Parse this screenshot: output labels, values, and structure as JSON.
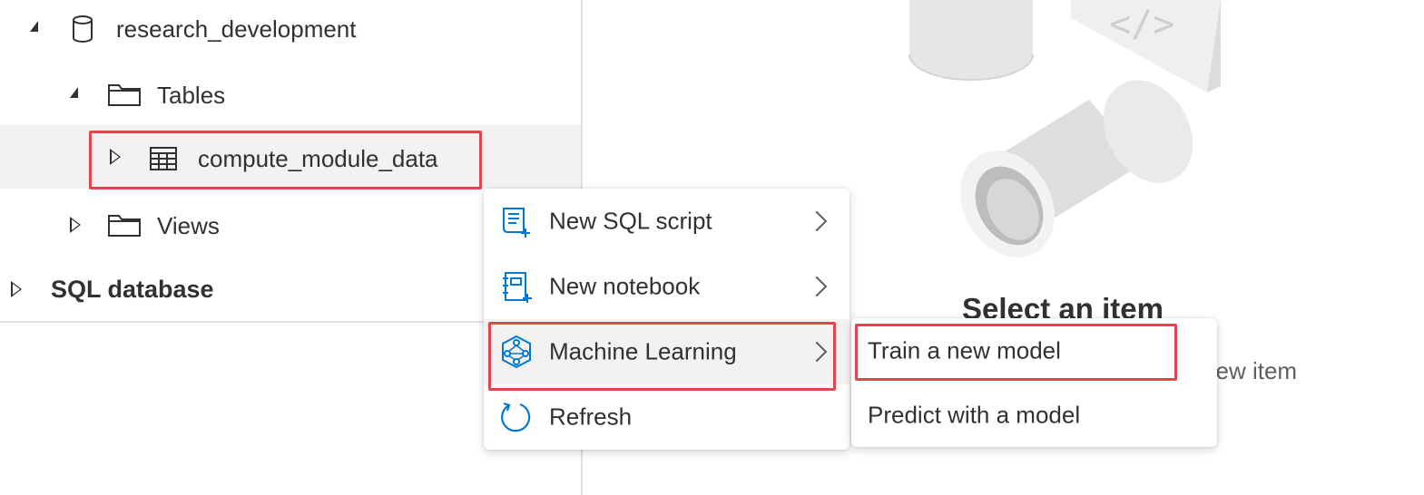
{
  "tree": {
    "database": {
      "label": "research_development"
    },
    "tables_folder": {
      "label": "Tables"
    },
    "table_item": {
      "label": "compute_module_data"
    },
    "views_folder": {
      "label": "Views"
    },
    "sql_database": {
      "label": "SQL database"
    }
  },
  "context_menu": {
    "items": [
      {
        "label": "New SQL script",
        "icon": "sql-script-icon"
      },
      {
        "label": "New notebook",
        "icon": "notebook-icon"
      },
      {
        "label": "Machine Learning",
        "icon": "machine-learning-icon"
      },
      {
        "label": "Refresh",
        "icon": "refresh-icon"
      }
    ]
  },
  "submenu": {
    "items": [
      {
        "label": "Train a new model"
      },
      {
        "label": "Predict with a model"
      }
    ]
  },
  "placeholder": {
    "title": "Select an item",
    "subtitle": "ate a new item"
  },
  "colors": {
    "accent": "#0078d4",
    "highlight_border": "#e0474c",
    "selected_row": "#f3f2f1"
  }
}
